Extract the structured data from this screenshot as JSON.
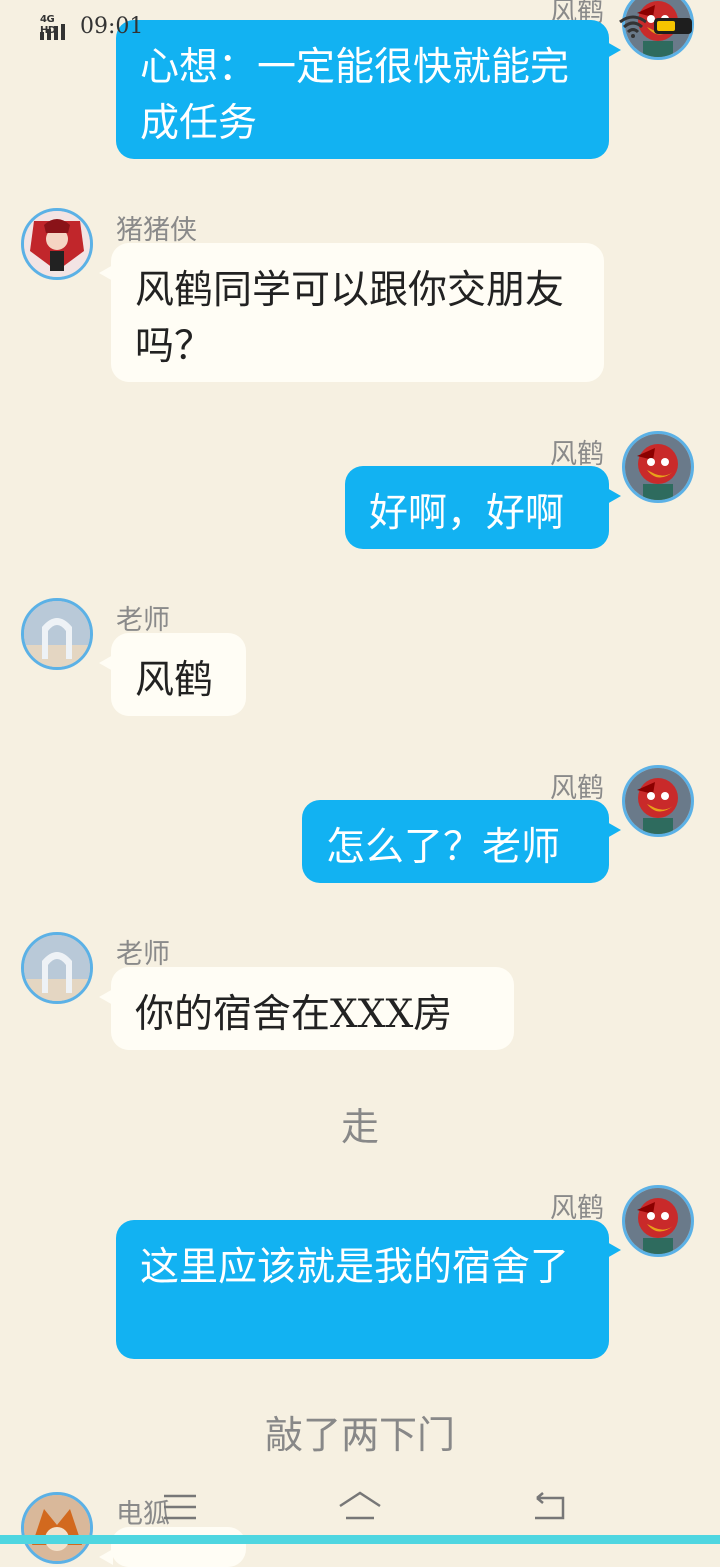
{
  "status_bar": {
    "network": "4G HD",
    "time": "09:01"
  },
  "messages": [
    {
      "side": "right",
      "name": "风鹤",
      "text": "心想：一定能很快就能完成任务",
      "avatar": "red-bird-avatar"
    },
    {
      "side": "left",
      "name": "猪猪侠",
      "text": "风鹤同学可以跟你交朋友吗？",
      "avatar": "red-anime-girl-avatar"
    },
    {
      "side": "right",
      "name": "风鹤",
      "text": "好啊，好啊",
      "avatar": "red-bird-avatar"
    },
    {
      "side": "left",
      "name": "老师",
      "text": "风鹤",
      "avatar": "archway-avatar"
    },
    {
      "side": "right",
      "name": "风鹤",
      "text": "怎么了？老师",
      "avatar": "red-bird-avatar"
    },
    {
      "side": "left",
      "name": "老师",
      "text": "你的宿舍在XXX房",
      "avatar": "archway-avatar"
    },
    {
      "side": "right",
      "name": "风鹤",
      "text": "这里应该就是我的宿舍了",
      "avatar": "red-bird-avatar"
    },
    {
      "side": "left",
      "name": "电狐",
      "text": "",
      "avatar": "fox-avatar"
    }
  ],
  "narrations": [
    "走",
    "敲了两下门"
  ],
  "nav": {
    "menu_icon": "menu-icon",
    "home_icon": "home-icon",
    "back_icon": "back-icon"
  },
  "colors": {
    "background": "#f6f0e1",
    "right_bubble": "#12b2f2",
    "left_bubble": "#fffdf5",
    "avatar_ring": "#5bb1e6"
  }
}
